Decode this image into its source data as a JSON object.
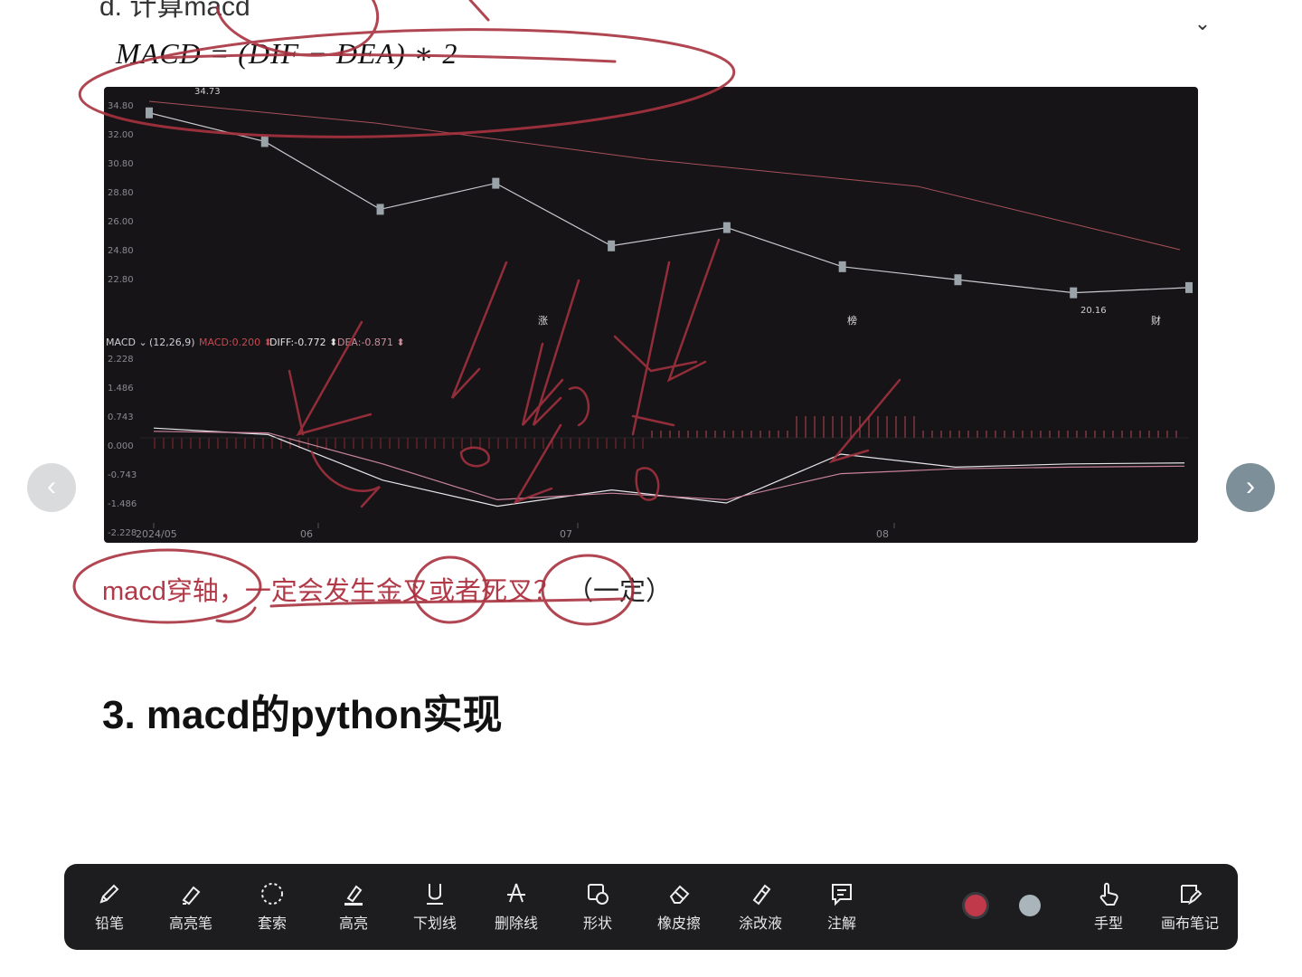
{
  "heading_top": "d. 计算macd",
  "formula": "MACD = (DIF − DEA) ∗ 2",
  "chart": {
    "price_ticks": [
      "34.80",
      "32.00",
      "30.80",
      "28.80",
      "26.00",
      "24.80",
      "22.80"
    ],
    "max_label": "34.73",
    "min_label": "20.16",
    "indicator": {
      "name": "MACD",
      "params": "(12,26,9)",
      "macd": "MACD:0.200",
      "diff": "DIFF:-0.772",
      "dea": "DEA:-0.871"
    },
    "macd_ticks": [
      "2.228",
      "1.486",
      "0.743",
      "0.000",
      "-0.743",
      "-1.486",
      "-2.228"
    ],
    "x_ticks": [
      "2024/05",
      "06",
      "07",
      "08"
    ],
    "markers": [
      "涨",
      "榜",
      "财"
    ]
  },
  "chart_data": {
    "type": "line",
    "title": "",
    "xlabel": "",
    "ylabel": "",
    "x": [
      "2024/05",
      "06",
      "07",
      "08"
    ],
    "ylim": [
      20.16,
      34.73
    ],
    "series": [
      {
        "values": [
          34.4,
          32.2,
          27.0,
          29.0,
          24.2,
          25.6,
          22.6,
          21.6,
          20.6,
          21.0
        ]
      },
      {
        "name": "DIFF",
        "values": [
          0.3,
          0.1,
          -1.3,
          -2.1,
          -1.6,
          -2.0,
          -0.5,
          -0.9,
          -0.8,
          -0.77
        ]
      },
      {
        "name": "DEA",
        "values": [
          0.2,
          0.15,
          -0.8,
          -1.9,
          -1.7,
          -1.9,
          -1.1,
          -0.95,
          -0.9,
          -0.87
        ]
      }
    ]
  },
  "question": {
    "part1": "macd穿轴，",
    "part2": "一定会发生",
    "part3": "金叉或者死叉？",
    "part4": "（一定）"
  },
  "section_heading": "3. macd的python实现",
  "toolbar": {
    "tools": [
      {
        "label": "铅笔",
        "icon": "pencil-icon"
      },
      {
        "label": "高亮笔",
        "icon": "highlighter-icon"
      },
      {
        "label": "套索",
        "icon": "lasso-icon"
      },
      {
        "label": "高亮",
        "icon": "highlight-icon"
      },
      {
        "label": "下划线",
        "icon": "underline-icon"
      },
      {
        "label": "删除线",
        "icon": "strikethrough-icon"
      },
      {
        "label": "形状",
        "icon": "shape-icon"
      },
      {
        "label": "橡皮擦",
        "icon": "eraser-icon"
      },
      {
        "label": "涂改液",
        "icon": "correction-fluid-icon"
      },
      {
        "label": "注解",
        "icon": "annotation-icon"
      },
      {
        "label": "手型",
        "icon": "hand-icon"
      },
      {
        "label": "画布笔记",
        "icon": "canvas-note-icon"
      }
    ],
    "colors": [
      "#c0394a",
      "#aab4bb"
    ]
  }
}
